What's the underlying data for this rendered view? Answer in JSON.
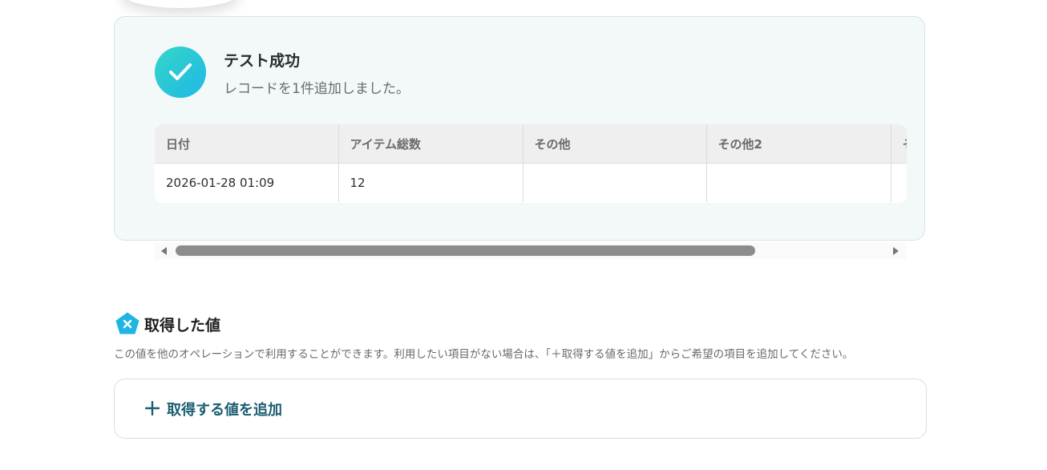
{
  "result": {
    "title": "テスト成功",
    "message": "レコードを1件追加しました。",
    "table": {
      "headers": [
        "日付",
        "アイテム総数",
        "その他",
        "その他2",
        "そ"
      ],
      "rows": [
        [
          "2026-01-28 01:09",
          "12",
          "",
          "",
          ""
        ]
      ]
    }
  },
  "acquired": {
    "title": "取得した値",
    "description": "この値を他のオペレーションで利用することができます。利用したい項目がない場合は、「＋取得する値を追加」からご希望の項目を追加してください。",
    "add_button_label": "取得する値を追加"
  },
  "colors": {
    "accent": "#1b5e70",
    "success_gradient_start": "#34d6c9",
    "success_gradient_end": "#1fb8e6",
    "card_background": "#f3f9f9"
  },
  "icons": {
    "success": "check-icon",
    "section": "yoom-pentagon-icon",
    "add": "plus-icon",
    "scroll_left": "arrow-left-icon",
    "scroll_right": "arrow-right-icon"
  }
}
